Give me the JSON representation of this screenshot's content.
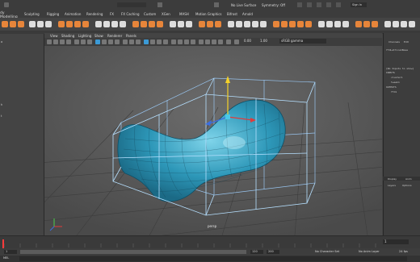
{
  "menubar": {
    "mode": "dy Modelling",
    "items": [
      "Sculpting",
      "Rigging",
      "Animation",
      "Rendering",
      "FX",
      "FX Caching",
      "Custom",
      "XGen",
      "MASH",
      "Motion Graphics",
      "Bifrost",
      "Arnold"
    ],
    "live_surface": "No Live Surface",
    "symmetry": "Symmetry: Off",
    "sign_in": "Sign In",
    "accent_color": "#37a5cc"
  },
  "viewport": {
    "menus": [
      "View",
      "Shading",
      "Lighting",
      "Show",
      "Renderer",
      "Panels"
    ],
    "field_a": "0.00",
    "field_b": "1.00",
    "color_space": "sRGB gamma",
    "camera_label": "persp",
    "wire_color": "#9fd0ff",
    "mesh_color": "#38a9c8"
  },
  "left_panel": {
    "items": [
      "a",
      "h",
      "t"
    ]
  },
  "right_panel": {
    "tab_channels": "Channels",
    "tab_edit": "Edit",
    "object_name": "ffdLattice1Base",
    "message_line": "[No Inputs to show]",
    "inputs_header": "INPUTS",
    "inputs": [
      "cluster1",
      "tweak1"
    ],
    "outputs_header": "OUTPUTS",
    "outputs": [
      "ffd1"
    ],
    "display_tab": "Display",
    "anim_tab": "Anim",
    "layers_label": "Layers",
    "options_label": "Options"
  },
  "timeline": {
    "frame": "1"
  },
  "range": {
    "start": "1",
    "end": "120",
    "range_end": "200",
    "char_set": "No Character Set",
    "anim_layer": "No Anim Layer",
    "fps": "24 fps"
  },
  "cmd": {
    "label": "MEL"
  }
}
